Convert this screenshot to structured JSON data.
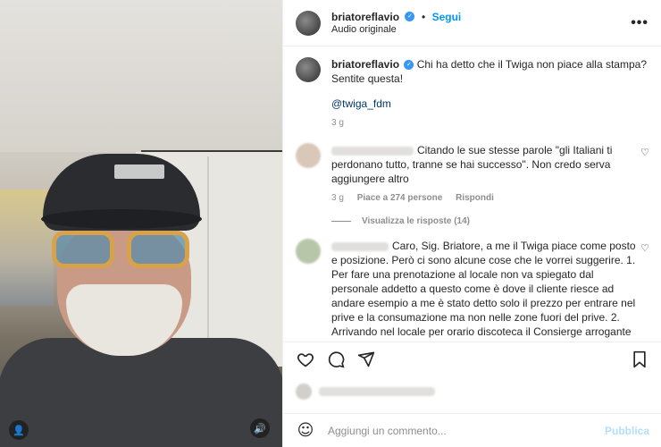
{
  "post": {
    "username": "briatoreflavio",
    "follow_label": "Segui",
    "audio": "Audio originale",
    "more_icon": "more-icon"
  },
  "caption": {
    "username": "briatoreflavio",
    "text": "Chi ha detto che il Twiga non piace alla stampa? Sentite questa!",
    "mention": "@twiga_fdm",
    "time": "3 g"
  },
  "comments": [
    {
      "text": "Citando le sue stesse parole \"gli Italiani ti perdonano tutto, tranne se hai successo\". Non credo serva aggiungere altro",
      "time": "3 g",
      "likes": "Piace a 274 persone",
      "reply": "Rispondi"
    },
    {
      "text": "Caro, Sig. Briatore, a me il Twiga piace come posto e posizione. Però ci sono alcune cose che le vorrei suggerire. 1. Per fare una prenotazione al locale non va spiegato dal personale addetto a questo come è dove il cliente riesce ad andare esempio a me è stato detto solo il prezzo per entrare nel prive e la consumazione ma non nelle zone fuori del prive. 2. Arrivando nel locale per orario discoteca il Consierge arrogante e non gentile come dovrebbe essere. Passato l'orario dei tavoli causa fila e sempre il Consierge basso livello"
    }
  ],
  "view_replies": "Visualizza le risposte (14)",
  "add_comment": {
    "placeholder": "Aggiungi un commento...",
    "publish": "Pubblica"
  },
  "colors": {
    "accent": "#0095f6",
    "publish_disabled": "#b2dffc",
    "verified": "#3897f0"
  }
}
